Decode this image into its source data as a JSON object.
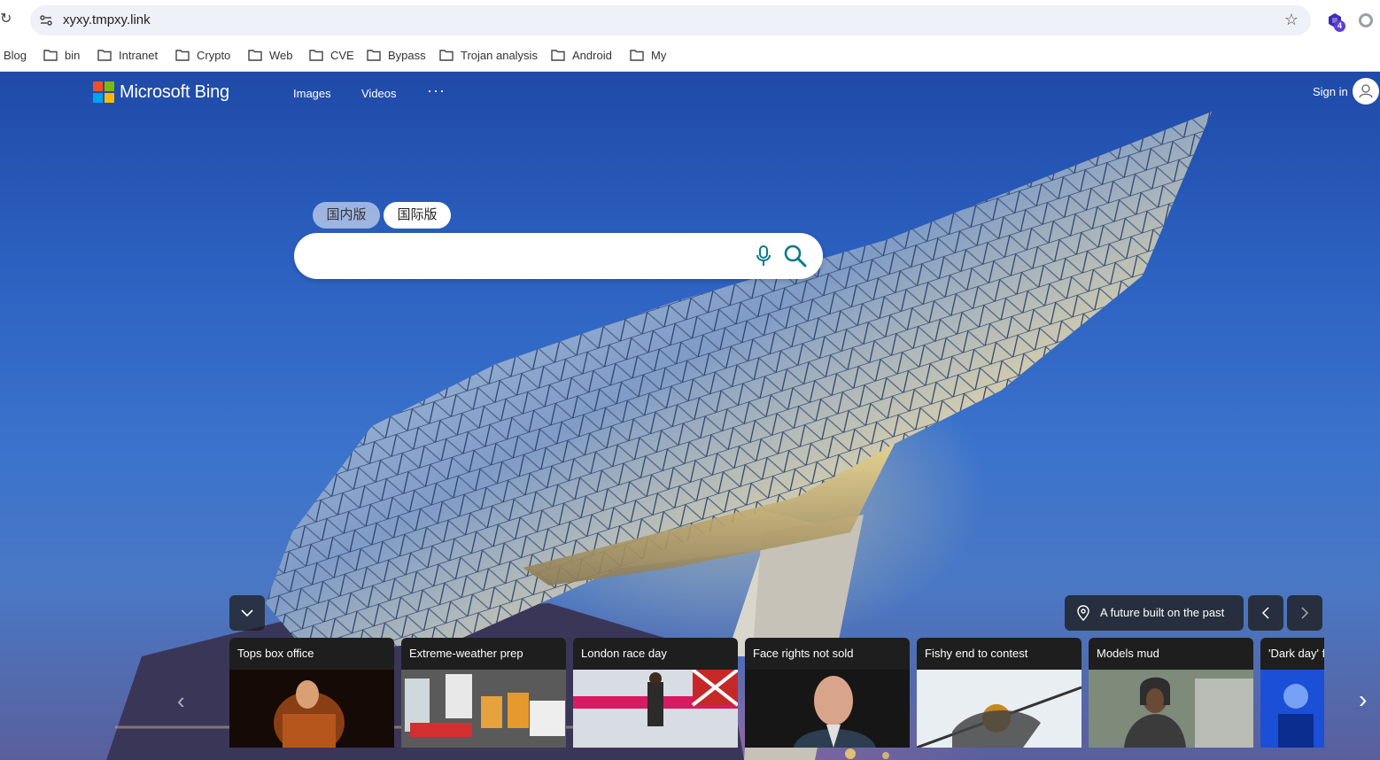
{
  "browser": {
    "url": "xyxy.tmpxy.link",
    "extension_badge": "4",
    "bookmarks": [
      "Blog",
      "bin",
      "Intranet",
      "Crypto",
      "Web",
      "CVE",
      "Bypass",
      "Trojan analysis",
      "Android",
      "My"
    ]
  },
  "bing": {
    "logo_text": "Microsoft Bing",
    "nav": {
      "images": "Images",
      "videos": "Videos",
      "more": "···"
    },
    "sign_in": "Sign in",
    "region_tabs": {
      "domestic": "国内版",
      "international": "国际版"
    },
    "search": {
      "value": "",
      "placeholder": ""
    },
    "image_caption": "A future built on the past",
    "news_cards": [
      "Tops box office",
      "Extreme-weather prep",
      "London race day",
      "Face rights not sold",
      "Fishy end to contest",
      "Models mud",
      "'Dark day' f"
    ]
  },
  "colors": {
    "accent": "#007daa",
    "search_icon": "#0b7a8c",
    "ext_badge": "#5b3fd6"
  }
}
